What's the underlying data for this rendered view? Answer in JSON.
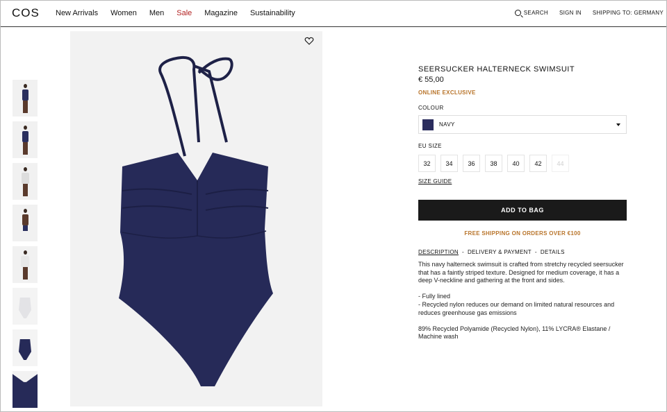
{
  "header": {
    "logo": "COS",
    "nav": [
      "New Arrivals",
      "Women",
      "Men",
      "Sale",
      "Magazine",
      "Sustainability"
    ],
    "search_label": "SEARCH",
    "sign_in_label": "SIGN IN",
    "shipping_label": "SHIPPING TO: GERMANY"
  },
  "product": {
    "title": "SEERSUCKER HALTERNECK SWIMSUIT",
    "price": "€ 55,00",
    "badge": "ONLINE EXCLUSIVE",
    "colour_label": "COLOUR",
    "colour_value": "NAVY",
    "colour_hex": "#2b2d5e",
    "size_label": "EU SIZE",
    "sizes": [
      {
        "label": "32",
        "available": true
      },
      {
        "label": "34",
        "available": true
      },
      {
        "label": "36",
        "available": true
      },
      {
        "label": "38",
        "available": true
      },
      {
        "label": "40",
        "available": true
      },
      {
        "label": "42",
        "available": true
      },
      {
        "label": "44",
        "available": false
      }
    ],
    "size_guide_label": "SIZE GUIDE",
    "add_to_bag_label": "ADD TO BAG",
    "shipping_note": "FREE SHIPPING ON ORDERS OVER €100",
    "tabs": [
      "DESCRIPTION",
      "DELIVERY & PAYMENT",
      "DETAILS"
    ],
    "description": [
      "This navy halterneck swimsuit is crafted from stretchy recycled seersucker that has a faintly striped texture. Designed for medium coverage, it has a deep V-neckline and gathering at the front and sides.",
      "- Fully lined\n- Recycled nylon reduces our demand on limited natural resources and reduces greenhouse gas emissions",
      "89% Recycled Polyamide (Recycled Nylon), 11% LYCRA® Elastane / Machine wash"
    ]
  },
  "colors": {
    "accent_orange": "#b8742a",
    "sale_red": "#b22222",
    "button_dark": "#1a1a1a",
    "swimsuit_navy": "#262a58"
  },
  "thumbnails": [
    "model-front",
    "model-standing",
    "model-shirt",
    "model-back",
    "model-shirt-close",
    "white-swimsuit",
    "navy-swimsuit",
    "fabric-closeup"
  ]
}
